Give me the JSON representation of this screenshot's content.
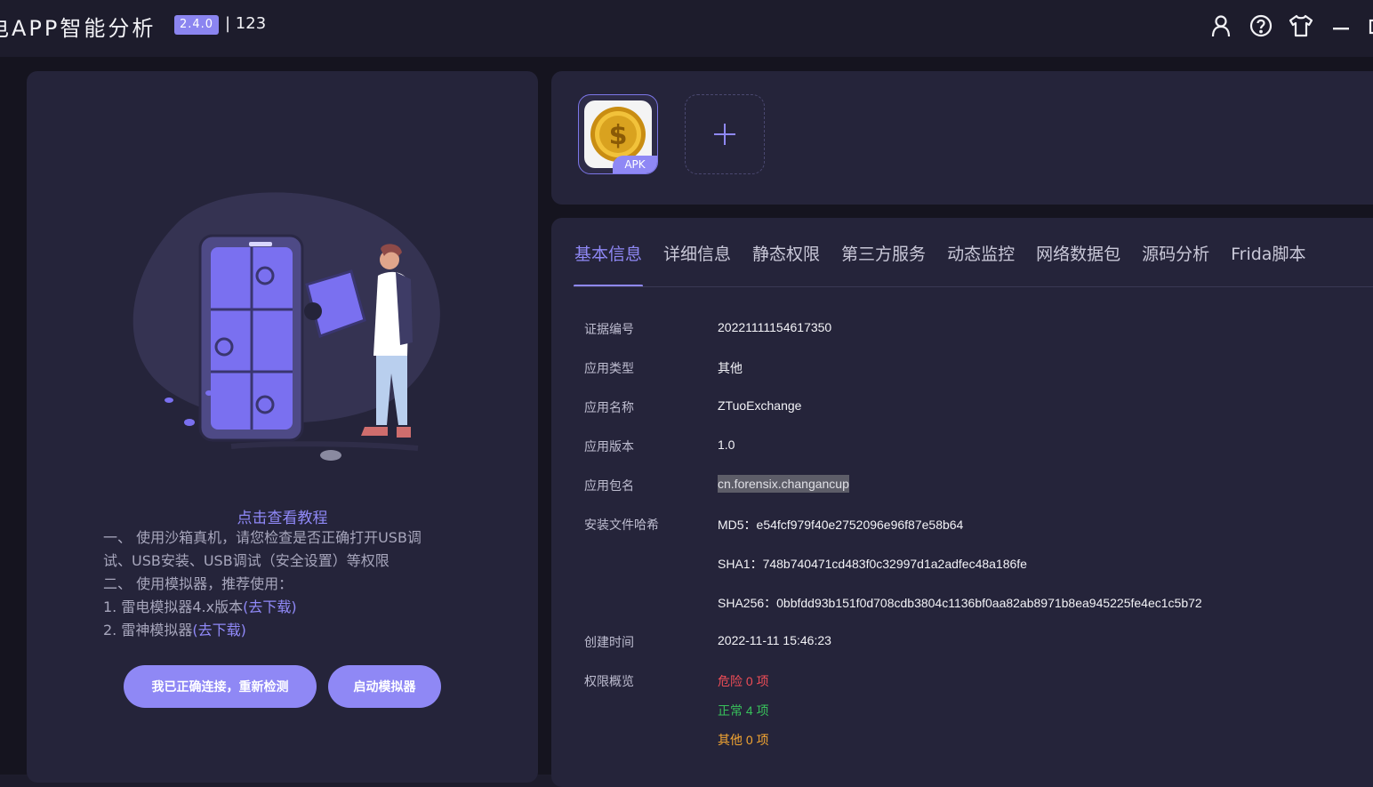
{
  "titlebar": {
    "app_title": "电APP智能分析",
    "version": "2.4.0",
    "user_id": "| 123",
    "icons": [
      "user-icon",
      "help-icon",
      "skin-icon",
      "minimize-icon",
      "maximize-icon"
    ]
  },
  "left": {
    "tutorial_link": "点击查看教程",
    "lines": [
      "一、 使用沙箱真机，请您检查是否正确打开USB调",
      "试、USB安装、USB调试（安全设置）等权限",
      "二、 使用模拟器，推荐使用："
    ],
    "emu1_text": "1. 雷电模拟器4.x版本",
    "emu1_link": "(去下载)",
    "emu2_text": "2. 雷神模拟器",
    "emu2_link": "(去下载)",
    "recheck_button": "我已正确连接，重新检测",
    "start_emulator_button": "启动模拟器"
  },
  "apk": {
    "tag": "APK",
    "add_label": "+"
  },
  "tabs": [
    "基本信息",
    "详细信息",
    "静态权限",
    "第三方服务",
    "动态监控",
    "网络数据包",
    "源码分析",
    "Frida脚本"
  ],
  "info": {
    "cert_label": "证据编号",
    "cert_value": "20221111154617350",
    "type_label": "应用类型",
    "type_value": "其他",
    "name_label": "应用名称",
    "name_value": "ZTuoExchange",
    "version_label": "应用版本",
    "version_value": "1.0",
    "package_label": "应用包名",
    "package_value": "cn.forensix.changancup",
    "hash_label": "安装文件哈希",
    "md5": "MD5：e54fcf979f40e2752096e96f87e58b64",
    "sha1": "SHA1：748b740471cd483f0c32997d1a2adfec48a186fe",
    "sha256": "SHA256：0bbfdd93b151f0d708cdb3804c1136bf0aa82ab8971b8ea945225fe4ec1c5b72",
    "created_label": "创建时间",
    "created_value": "2022-11-11 15:46:23",
    "perm_label": "权限概览",
    "danger": "危险 0 项",
    "normal": "正常 4 项",
    "other": "其他 0 项"
  },
  "colors": {
    "accent": "#8f88f5",
    "danger": "#ee4d57",
    "normal": "#38c15b",
    "other": "#f3a531"
  }
}
